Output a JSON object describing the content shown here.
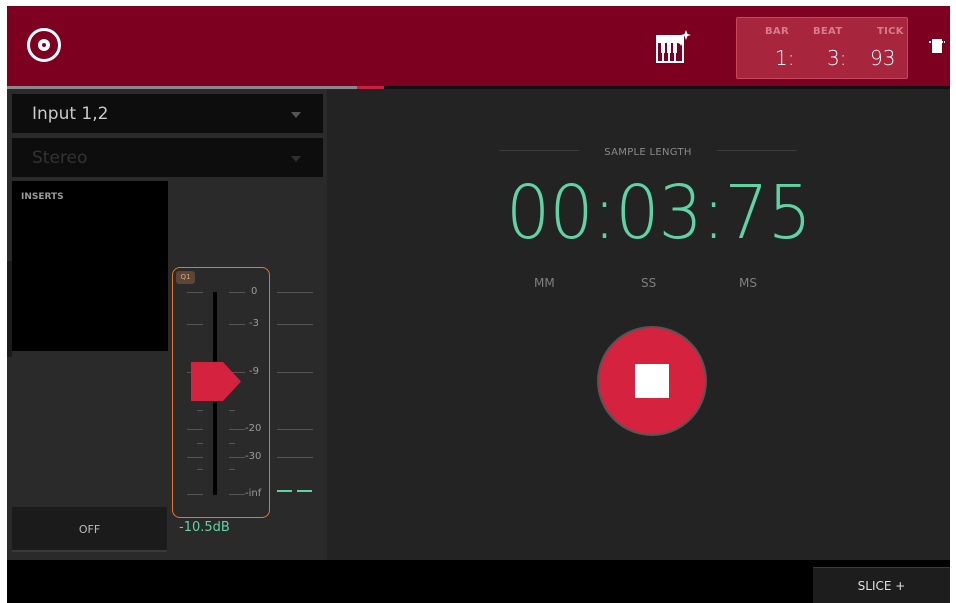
{
  "header": {
    "logo_icon": "vinyl-record-icon",
    "keyboard_icon": "keyboard-sparkle-icon",
    "cpu_icon": "cpu-chip-icon",
    "counter": {
      "bar_label": "BAR",
      "beat_label": "BEAT",
      "tick_label": "TICK",
      "bar_value": "1:",
      "beat_value": "3:",
      "tick_value": "93"
    }
  },
  "left_panel": {
    "input_select": "Input 1,2",
    "mode_select": "Stereo",
    "inserts_label": "INSERTS",
    "off_label": "OFF",
    "fader": {
      "tag": "Q1",
      "db_marks": [
        "0",
        "-3",
        "-9",
        "-20",
        "-30",
        "-inf"
      ],
      "value": "-10.5dB"
    }
  },
  "main": {
    "sample_length_label": "SAMPLE LENGTH",
    "sample_time": "00:03:75",
    "units": [
      "MM",
      "SS",
      "MS"
    ]
  },
  "bottom": {
    "slice_label": "SLICE +"
  },
  "colors": {
    "header_bg": "#7e0020",
    "accent_green": "#5fd3a3",
    "stop_red": "#d5223f",
    "fader_orange": "#d97a2c"
  }
}
